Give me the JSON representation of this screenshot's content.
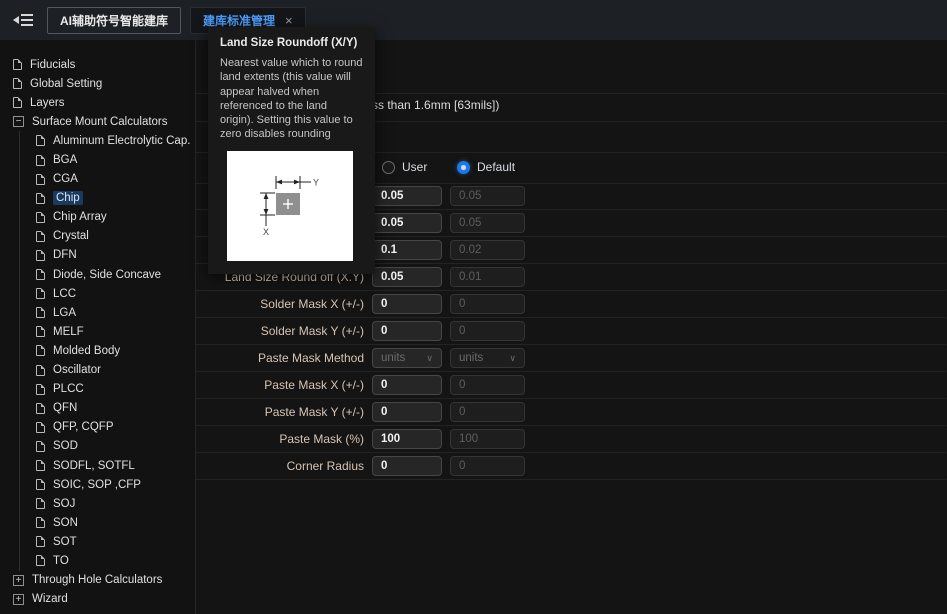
{
  "topbar": {
    "tabs": [
      {
        "label": "AI辅助符号智能建库",
        "active": false
      },
      {
        "label": "建库标准管理",
        "active": true,
        "close_icon": "×"
      }
    ]
  },
  "sidebar": {
    "selected_item": "Chip",
    "items": [
      {
        "label": "Fiducials",
        "level": 0,
        "icon": "file"
      },
      {
        "label": "Global Setting",
        "level": 0,
        "icon": "file"
      },
      {
        "label": "Layers",
        "level": 0,
        "icon": "file"
      },
      {
        "label": "Surface Mount Calculators",
        "level": 0,
        "icon": "collapse",
        "glyph": "−"
      },
      {
        "label": "Aluminum Electrolytic Cap.",
        "level": 1,
        "icon": "file"
      },
      {
        "label": "BGA",
        "level": 1,
        "icon": "file"
      },
      {
        "label": "CGA",
        "level": 1,
        "icon": "file"
      },
      {
        "label": "Chip",
        "level": 1,
        "icon": "file",
        "selected": true
      },
      {
        "label": "Chip Array",
        "level": 1,
        "icon": "file"
      },
      {
        "label": "Crystal",
        "level": 1,
        "icon": "file"
      },
      {
        "label": "DFN",
        "level": 1,
        "icon": "file"
      },
      {
        "label": "Diode, Side Concave",
        "level": 1,
        "icon": "file"
      },
      {
        "label": "LCC",
        "level": 1,
        "icon": "file"
      },
      {
        "label": "LGA",
        "level": 1,
        "icon": "file"
      },
      {
        "label": "MELF",
        "level": 1,
        "icon": "file"
      },
      {
        "label": "Molded Body",
        "level": 1,
        "icon": "file"
      },
      {
        "label": "Oscillator",
        "level": 1,
        "icon": "file"
      },
      {
        "label": "PLCC",
        "level": 1,
        "icon": "file"
      },
      {
        "label": "QFN",
        "level": 1,
        "icon": "file"
      },
      {
        "label": "QFP, CQFP",
        "level": 1,
        "icon": "file"
      },
      {
        "label": "SOD",
        "level": 1,
        "icon": "file"
      },
      {
        "label": "SODFL, SOTFL",
        "level": 1,
        "icon": "file"
      },
      {
        "label": "SOIC, SOP ,CFP",
        "level": 1,
        "icon": "file"
      },
      {
        "label": "SOJ",
        "level": 1,
        "icon": "file"
      },
      {
        "label": "SON",
        "level": 1,
        "icon": "file"
      },
      {
        "label": "SOT",
        "level": 1,
        "icon": "file"
      },
      {
        "label": "TO",
        "level": 1,
        "icon": "file"
      },
      {
        "label": "Through Hole Calculators",
        "level": 0,
        "icon": "expand",
        "glyph": "+"
      },
      {
        "label": "Wizard",
        "level": 0,
        "icon": "expand",
        "glyph": "+"
      }
    ]
  },
  "main": {
    "subtitle_fragment": "ss than 1.6mm [63mils])",
    "radio_group": {
      "options": [
        {
          "label": "User",
          "selected": false
        },
        {
          "label": "Default",
          "selected": true
        }
      ]
    },
    "rows": [
      {
        "label": "",
        "value": "0.05",
        "default": "0.05",
        "control": "input"
      },
      {
        "label": "",
        "value": "0.05",
        "default": "0.05",
        "control": "input"
      },
      {
        "label": "",
        "value": "0.1",
        "default": "0.02",
        "control": "input"
      },
      {
        "label": "Land Size Round off (X.Y)",
        "value": "0.05",
        "default": "0.01",
        "control": "input"
      },
      {
        "label": "Solder Mask X (+/-)",
        "value": "0",
        "default": "0",
        "control": "input"
      },
      {
        "label": "Solder Mask Y (+/-)",
        "value": "0",
        "default": "0",
        "control": "input"
      },
      {
        "label": "Paste Mask Method",
        "value": "units",
        "default": "units",
        "control": "select",
        "chevron": "∨"
      },
      {
        "label": "Paste Mask X (+/-)",
        "value": "0",
        "default": "0",
        "control": "input"
      },
      {
        "label": "Paste Mask Y (+/-)",
        "value": "0",
        "default": "0",
        "control": "input"
      },
      {
        "label": "Paste Mask (%)",
        "value": "100",
        "default": "100",
        "control": "input"
      },
      {
        "label": "Corner Radius",
        "value": "0",
        "default": "0",
        "control": "input"
      }
    ]
  },
  "tooltip": {
    "title": "Land Size Roundoff (X/Y)",
    "body": "Nearest value which to round land extents (this value will appear halved when referenced to the land origin). Setting this value to zero disables rounding",
    "diagram": {
      "x_label": "X",
      "y_label": "Y",
      "center_mark": "+"
    }
  },
  "colors": {
    "active_tab_text": "#4da0ff",
    "radio_selected": "#1f78e8",
    "selected_tree_highlight": "#1c3a5e",
    "field_label": "#d6c4b4",
    "diagram_square": "#8f8f8f"
  }
}
